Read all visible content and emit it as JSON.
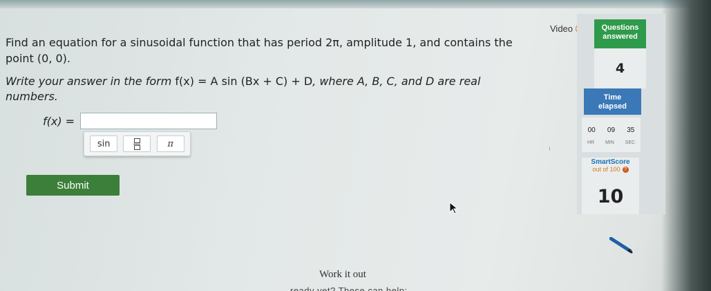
{
  "question": {
    "line1": "Find an equation for a sinusoidal function that has period 2π, amplitude 1, and contains the",
    "line2": "point (0, 0).",
    "instruction_pre": "Write your answer in the form ",
    "form": "f(x) = A sin (Bx + C) + D",
    "instruction_post": ", where A, B, C, and D are real",
    "instruction_line2": "numbers."
  },
  "answer": {
    "lhs": "f(x) =",
    "value": ""
  },
  "keypad": {
    "sin_label": "sin",
    "fraction_icon": "fraction-icon",
    "pi_label": "π"
  },
  "submit_label": "Submit",
  "video_label": "Video",
  "sidebar": {
    "questions_label_1": "Questions",
    "questions_label_2": "answered",
    "questions_count": "4",
    "time_label_1": "Time",
    "time_label_2": "elapsed",
    "time_hr": "00",
    "time_min": "09",
    "time_sec": "35",
    "hr_label": "HR",
    "min_label": "MIN",
    "sec_label": "SEC",
    "smartscore_label": "SmartScore",
    "smartscore_sub": "out of 100",
    "smartscore_value": "10"
  },
  "work_it_out": "Work it out",
  "ready_text": "ready yet? These can help:",
  "colors": {
    "submit": "#3b7f3a",
    "questions_card": "#2f9a4a",
    "time_card": "#3a78b7",
    "smartscore_title": "#1b6fb5"
  }
}
